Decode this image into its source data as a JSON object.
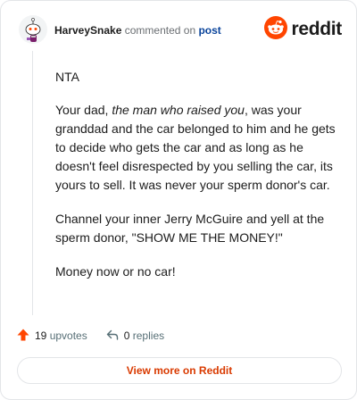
{
  "header": {
    "username": "HarveySnake",
    "action": "commented on",
    "post_link": "post",
    "brand_name": "reddit"
  },
  "comment": {
    "p1": "NTA",
    "p2_before": "Your dad, ",
    "p2_em": "the man who raised you",
    "p2_after": ", was your granddad and the car belonged to him and he gets to decide who gets the car and as long as he doesn't feel disrespected by you selling the car, its yours to sell. It was never your sperm donor's car.",
    "p3": "Channel your inner Jerry McGuire and yell at the sperm donor, \"SHOW ME THE MONEY!\"",
    "p4": "Money now or no car!"
  },
  "footer": {
    "upvotes_count": "19",
    "upvotes_label": "upvotes",
    "replies_count": "0",
    "replies_label": "replies",
    "view_more_label": "View more on Reddit"
  },
  "colors": {
    "brand_orange": "#ff4500",
    "link_blue": "#0a449b",
    "cta_text": "#d93a00"
  },
  "icons": {
    "avatar": "snoo-avatar-icon",
    "logo": "reddit-snoo-icon",
    "upvote": "upvote-arrow-icon",
    "reply": "reply-arrow-icon"
  }
}
